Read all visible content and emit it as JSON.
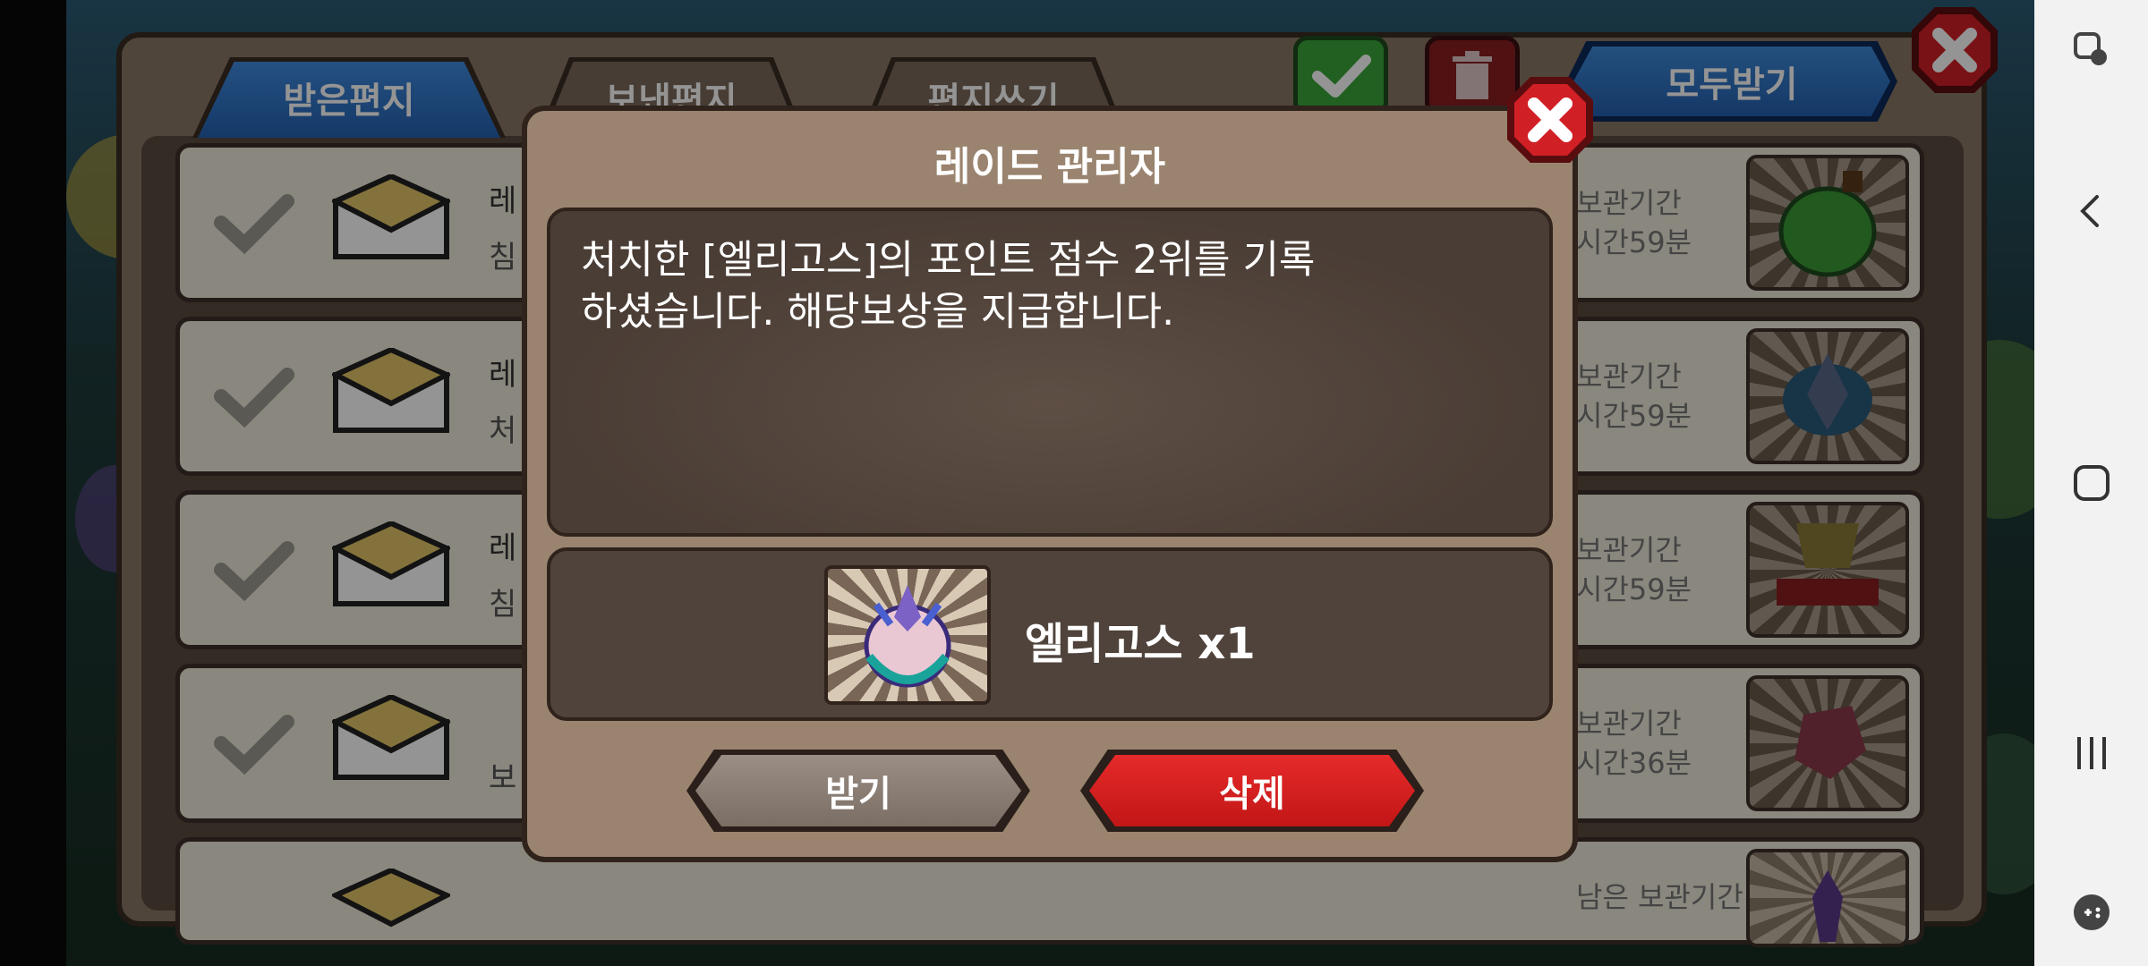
{
  "mailbox": {
    "tabs": [
      {
        "label": "받은편지",
        "active": true
      },
      {
        "label": "보낸편지",
        "active": false
      },
      {
        "label": "편지쓰기",
        "active": false
      }
    ],
    "get_all_label": "모두받기",
    "rows": [
      {
        "sender": "레",
        "subject": "침",
        "keep_1": "보관기간",
        "keep_2": "시간59분",
        "thumb_icon": "green-potion-icon"
      },
      {
        "sender": "레",
        "subject": "처",
        "keep_1": "보관기간",
        "keep_2": "시간59분",
        "thumb_icon": "dragon-emblem-icon"
      },
      {
        "sender": "레",
        "subject": "침",
        "keep_1": "보관기간",
        "keep_2": "시간59분",
        "thumb_icon": "rp-trophy-icon"
      },
      {
        "sender": "",
        "subject": "보",
        "keep_1": "보관기간",
        "keep_2": "시간36분",
        "thumb_icon": "red-gem-icon"
      },
      {
        "sender": "",
        "subject": "",
        "keep_1": "남은 보관기간",
        "keep_2": "",
        "thumb_icon": "purple-crystal-icon"
      }
    ]
  },
  "modal": {
    "title": "레이드 관리자",
    "message": "처치한 [엘리고스]의 포인트 점수 2위를 기록\n하셨습니다. 해당보상을 지급합니다.",
    "reward_label": "엘리고스 x1",
    "reward_icon": "eligos-dragon-icon",
    "receive_label": "받기",
    "delete_label": "삭제"
  },
  "colors": {
    "modal_bg": "#9a846f",
    "receive_button": "#8a7d72",
    "delete_button": "#d21f1f",
    "tab_active": "#2f74c4",
    "close_red": "#d11f26",
    "confirm_green": "#3aa63a"
  },
  "navbar_icons": [
    "accessibility-touch-icon",
    "back-icon",
    "home-icon",
    "recents-icon",
    "game-launcher-icon"
  ]
}
